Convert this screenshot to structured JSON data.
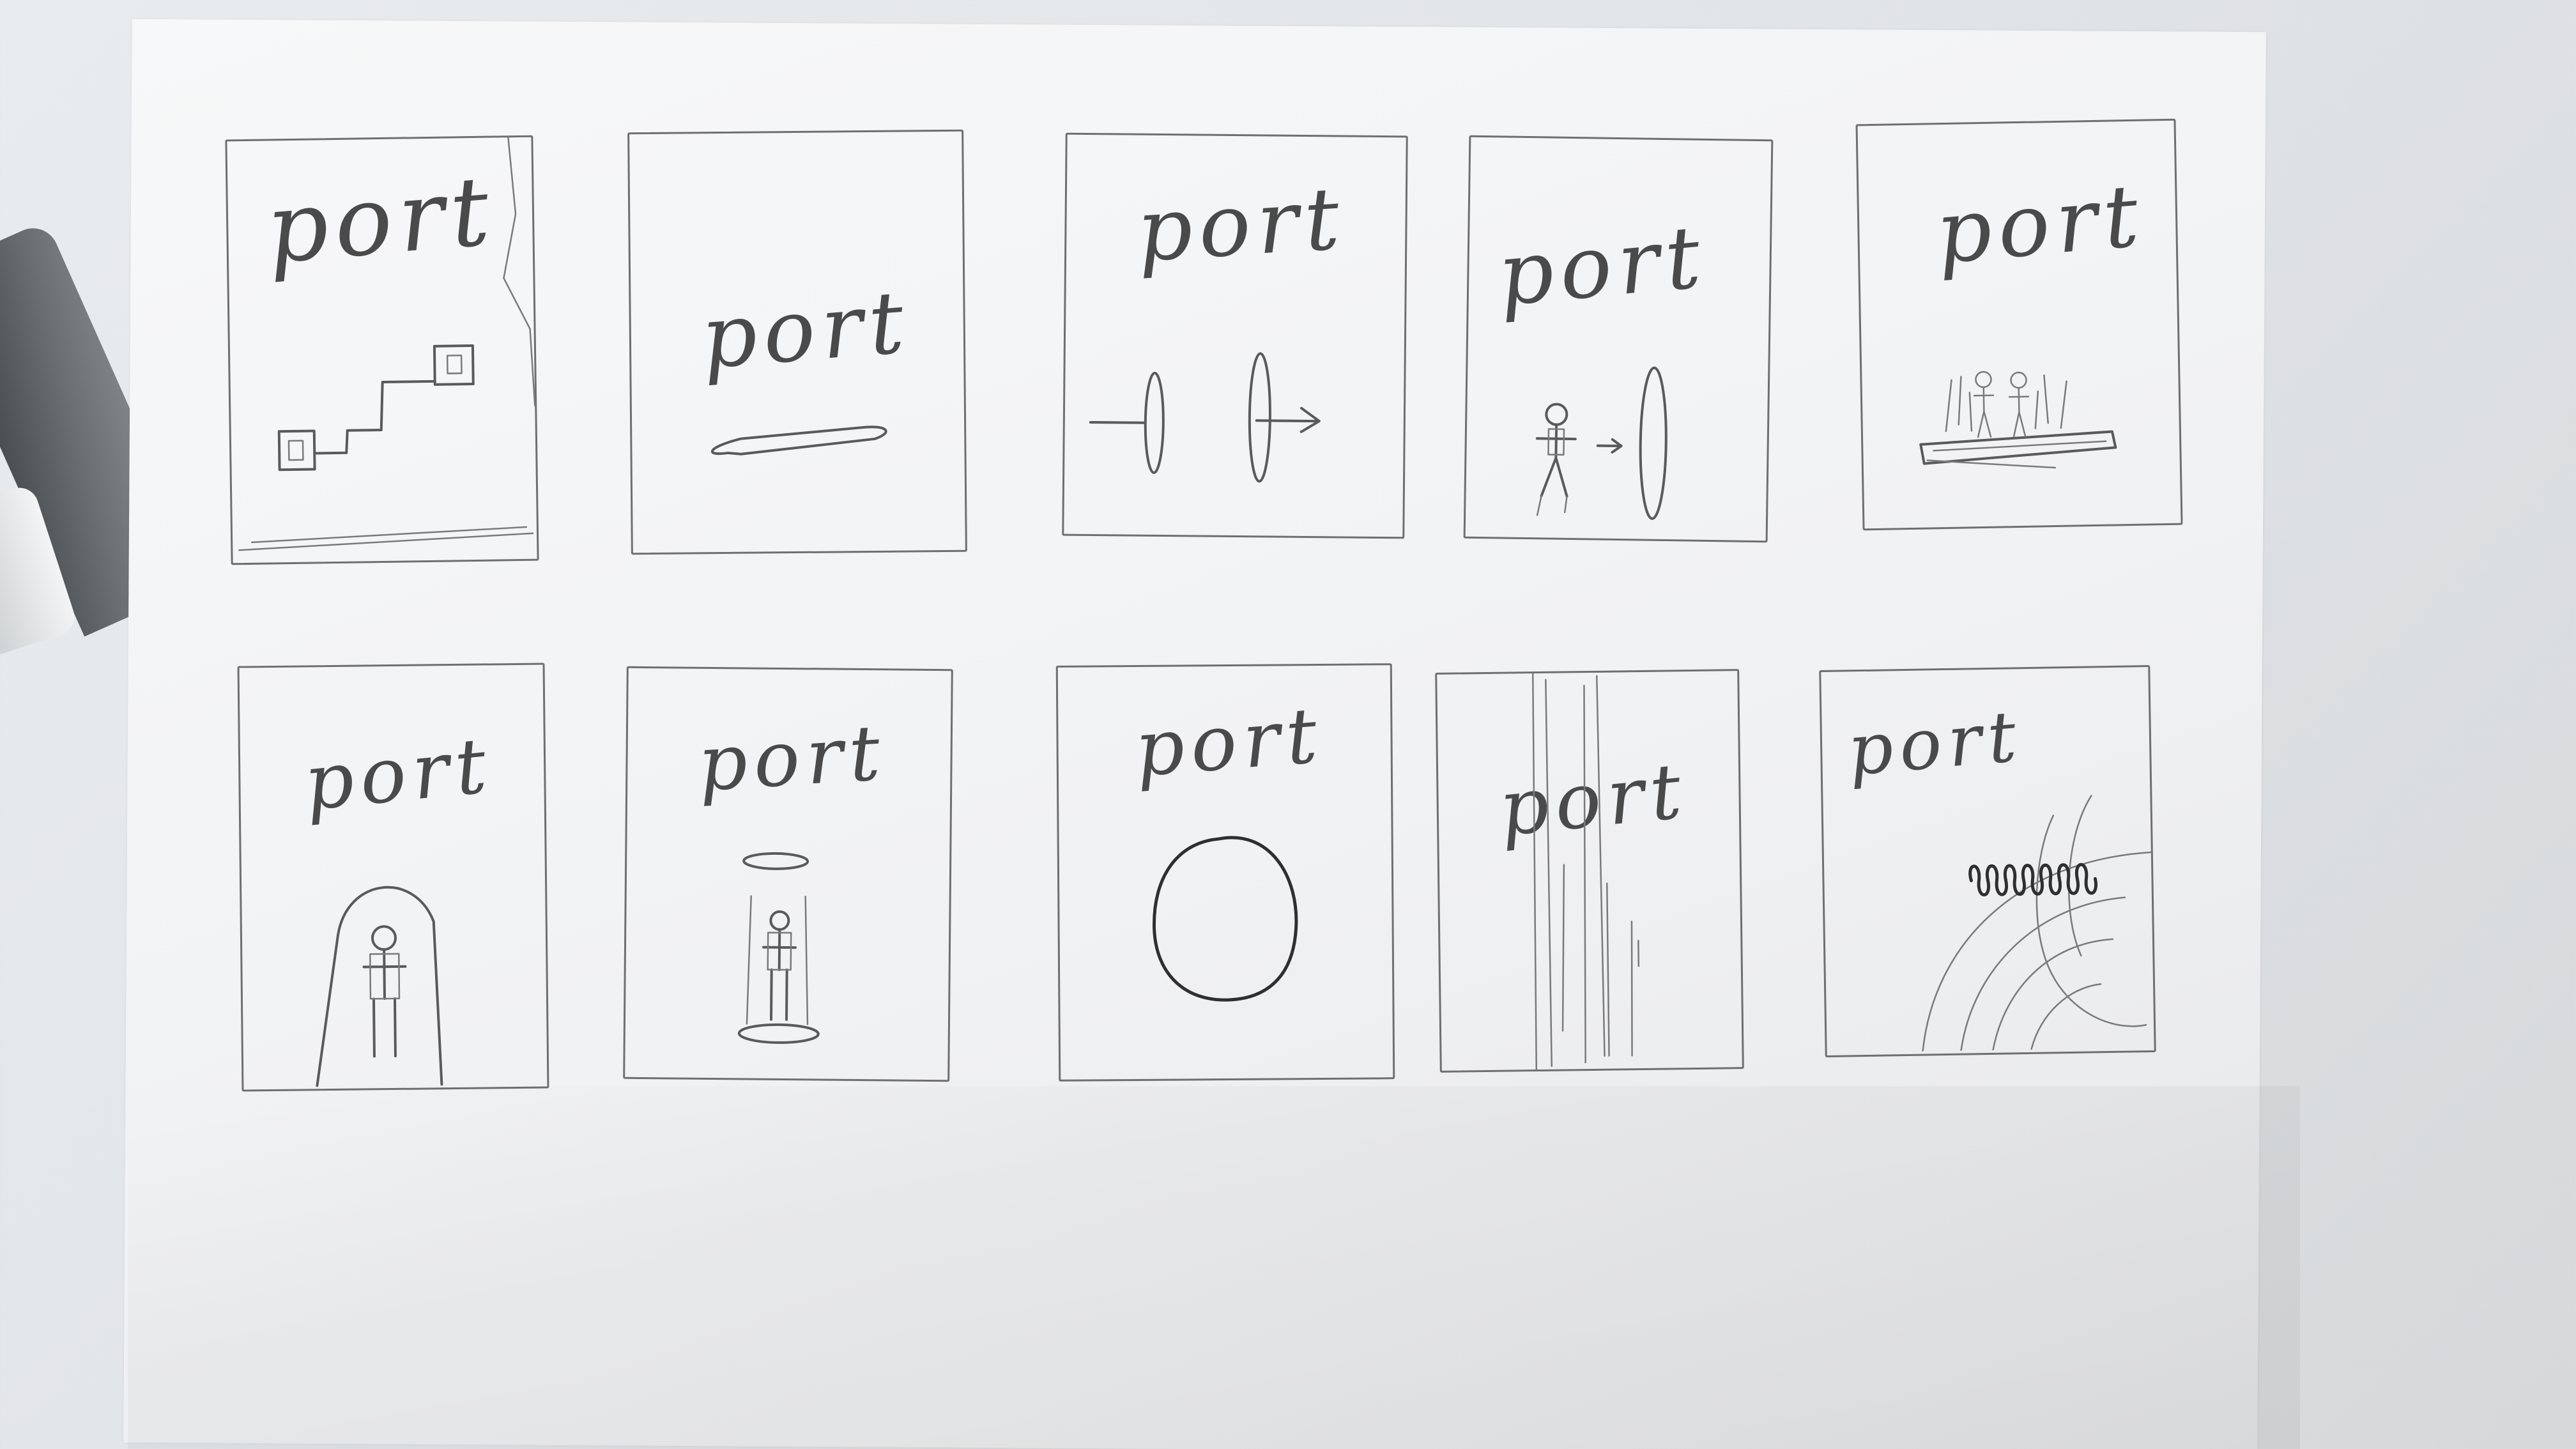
{
  "panels": [
    {
      "word": "port",
      "sketch": "two-boxes-connected-by-steps"
    },
    {
      "word": "port",
      "sketch": "flat-oval-platform"
    },
    {
      "word": "port",
      "sketch": "two-portals-with-arrows"
    },
    {
      "word": "port",
      "sketch": "stick-figure-walking-to-portal"
    },
    {
      "word": "port",
      "sketch": "two-figures-on-glowing-platform"
    },
    {
      "word": "port",
      "sketch": "figure-inside-arch"
    },
    {
      "word": "port",
      "sketch": "figure-in-teleport-beam"
    },
    {
      "word": "port",
      "sketch": "large-circle"
    },
    {
      "word": "port",
      "sketch": "vertical-streaks"
    },
    {
      "word": "port",
      "sketch": "coil-and-concentric-arcs"
    }
  ]
}
